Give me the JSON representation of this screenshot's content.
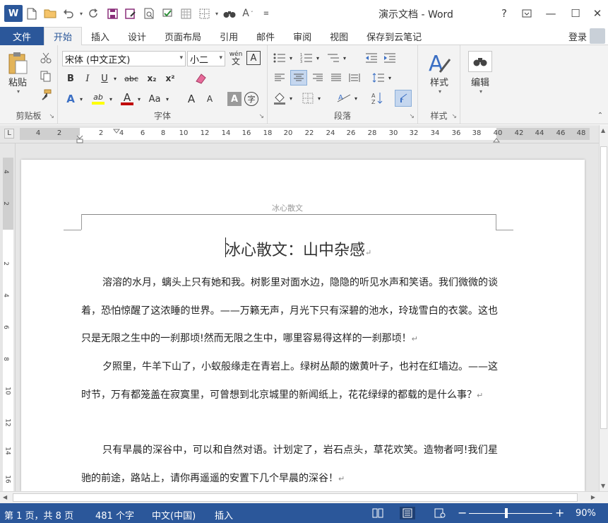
{
  "title_bar": {
    "document_title": "演示文档 - Word",
    "logo_letter": "W",
    "help": "?",
    "minimize": "—",
    "maximize": "☐",
    "close": "✕"
  },
  "tabs": {
    "file": "文件",
    "items": [
      "开始",
      "插入",
      "设计",
      "页面布局",
      "引用",
      "邮件",
      "审阅",
      "视图",
      "保存到云笔记"
    ],
    "active": "开始",
    "login": "登录"
  },
  "ribbon": {
    "clipboard": {
      "label": "剪贴板",
      "paste": "粘贴"
    },
    "font": {
      "label": "字体",
      "font_name": "宋体 (中文正文)",
      "font_size": "小二",
      "bold": "B",
      "italic": "I",
      "underline": "U",
      "strike": "abc",
      "subscript": "x₂",
      "superscript": "x²",
      "text_effects": "A",
      "highlight": "ab",
      "font_color": "A",
      "change_case": "Aa",
      "grow": "A",
      "shrink": "A",
      "char_shading": "A",
      "enclose": "字",
      "phonetic": "wén",
      "border_char": "A",
      "font_color_hex": "#c00000",
      "highlight_hex": "#ffff00"
    },
    "paragraph": {
      "label": "段落"
    },
    "styles": {
      "label": "样式",
      "button": "样式"
    },
    "editing": {
      "button": "编辑"
    }
  },
  "ruler": {
    "ticks": [
      "4",
      "2",
      "2",
      "4",
      "6",
      "8",
      "10",
      "12",
      "14",
      "16",
      "18",
      "20",
      "22",
      "24",
      "26",
      "28",
      "30",
      "32",
      "34",
      "36",
      "38",
      "40",
      "42",
      "44",
      "46",
      "48"
    ],
    "vticks": [
      "4",
      "2",
      "2",
      "4",
      "6",
      "8",
      "10",
      "12",
      "14",
      "16"
    ],
    "selector": "L"
  },
  "document": {
    "header": "冰心散文",
    "heading": "冰心散文：山中杂感",
    "paragraphs": [
      "溶溶的水月，螭头上只有她和我。树影里对面水边，隐隐的听见水声和笑语。我们微微的谈着，恐怕惊醒了这浓睡的世界。——万籁无声，月光下只有深碧的池水，玲珑雪白的衣裳。这也只是无限之生中的一刹那顷!然而无限之生中，哪里容易得这样的一刹那顷！",
      "夕照里，牛羊下山了，小蚁般缘走在青岩上。绿树丛颠的嫩黄叶子，也衬在红墙边。——这时节，万有都笼盖在寂寞里，可曾想到北京城里的新闻纸上，花花绿绿的都载的是什么事？",
      "只有早晨的深谷中，可以和自然对语。计划定了，岩石点头，草花欢笑。造物者呵!我们星驰的前途，路站上，请你再遥遥的安置下几个早晨的深谷！"
    ]
  },
  "status_bar": {
    "page": "第 1 页，共 8 页",
    "words": "481 个字",
    "language": "中文(中国)",
    "mode": "插入",
    "zoom": "90%",
    "zoom_minus": "−",
    "zoom_plus": "+"
  },
  "colors": {
    "accent": "#2b579a",
    "ribbon_bg": "#f3f3f3"
  }
}
